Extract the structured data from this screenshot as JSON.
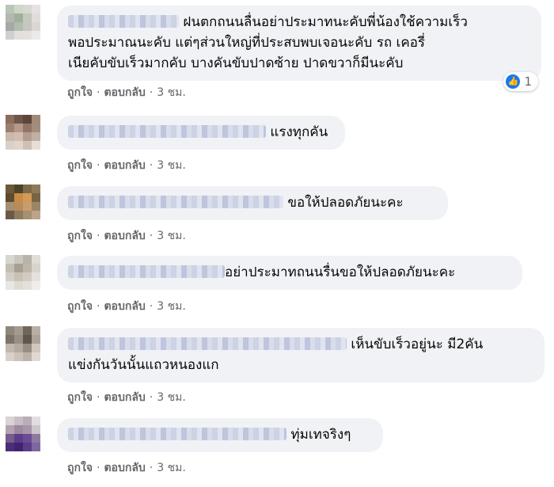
{
  "comments": [
    {
      "text_lines": [
        "ฝนตกถนนลื่นอย่าประมาทนะคับพี่น้องใช้ความเร็ว",
        "พอประมาณนะคับ แต่ๆส่วนใหญ่ที่ประสบพบเจอนะคับ รถ เคอรี่",
        "เนียคับขับเร็วมากคับ บางคันขับปาดซ้าย ปาดขวาก็มีนะคับ"
      ],
      "like": "ถูกใจ",
      "reply": "ตอบกลับ",
      "time": "3 ชม.",
      "reaction_count": "1",
      "avatar_colors": [
        "#b9c7b8",
        "#cfd7c9",
        "#d6d9d2",
        "#e6e2e1",
        "#b6b7b0",
        "#9fb09a",
        "#c2c9bd",
        "#dfdcda",
        "#a7a9a7",
        "#b2bcb2",
        "#c6c7c0",
        "#d9d6d3",
        "#cfd0ce",
        "#e1e0de",
        "#e4e1df",
        "#ece9e7"
      ]
    },
    {
      "text_lines": [
        "แรงทุกคัน"
      ],
      "like": "ถูกใจ",
      "reply": "ตอบกลับ",
      "time": "3 ชม.",
      "avatar_colors": [
        "#8a6d5c",
        "#6d5548",
        "#5c4638",
        "#a08b7b",
        "#9c7f6d",
        "#b5998a",
        "#8f7566",
        "#a48d7d",
        "#c9b8ac",
        "#d2bdb0",
        "#b39d8f",
        "#c1afa3",
        "#dad0c9",
        "#e0d4cb",
        "#cfc0b5",
        "#e6ded9"
      ]
    },
    {
      "text_lines": [
        "ขอให้ปลอดภัยนะคะ"
      ],
      "like": "ถูกใจ",
      "reply": "ตอบกลับ",
      "time": "3 ชม.",
      "avatar_colors": [
        "#6b5a3a",
        "#4e4129",
        "#7c6a47",
        "#8d7b58",
        "#5f4a2d",
        "#c98a46",
        "#d39a55",
        "#7a6342",
        "#a48f70",
        "#b88b58",
        "#c79d6c",
        "#9c8566",
        "#6a5a45",
        "#8f7a5d",
        "#a79071",
        "#bba586"
      ]
    },
    {
      "text_lines": [
        "อย่าประมาทถนนรื่นขอให้ปลอดภัยนะคะ"
      ],
      "like": "ถูกใจ",
      "reply": "ตอบกลับ",
      "time": "3 ชม.",
      "avatar_colors": [
        "#d7d6d1",
        "#c9c6bd",
        "#b8b3a8",
        "#e0ddd6",
        "#c4bfb3",
        "#a79f92",
        "#bdb6a9",
        "#d8d3cb",
        "#d3cec6",
        "#c8c1b4",
        "#d1ccc3",
        "#e5e2dd",
        "#e9e7e3",
        "#dedad4",
        "#e4e0da",
        "#efedea"
      ]
    },
    {
      "text_lines": [
        "เห็นขับเร็วอยู่นะ มี2คัน",
        "แข่งกันวันนั้นแถวหนองแก"
      ],
      "like": "ถูกใจ",
      "reply": "ตอบกลับ",
      "time": "3 ชม.",
      "avatar_colors": [
        "#8f867c",
        "#a3998e",
        "#6f665c",
        "#b9afa4",
        "#7d7369",
        "#9a8f84",
        "#5e554c",
        "#aea398",
        "#c2b8ad",
        "#b4aa9f",
        "#988d82",
        "#d0c7be",
        "#d9d1c9",
        "#cbc2b9",
        "#bcb2a8",
        "#e0d9d2"
      ]
    },
    {
      "text_lines": [
        "ทุ่มเทจริงๆ"
      ],
      "like": "ถูกใจ",
      "reply": "ตอบกลับ",
      "time": "3 ชม.",
      "avatar_colors": [
        "#d9d3d6",
        "#c8bfc6",
        "#b9adb6",
        "#e2dde0",
        "#b3a3b0",
        "#9d8aa0",
        "#a896a8",
        "#cfc5cd",
        "#7a5c8a",
        "#5b3d8c",
        "#6a4c96",
        "#8e7aa0",
        "#4b2e7a",
        "#3e2470",
        "#5a3c88",
        "#7d67a0"
      ]
    }
  ]
}
